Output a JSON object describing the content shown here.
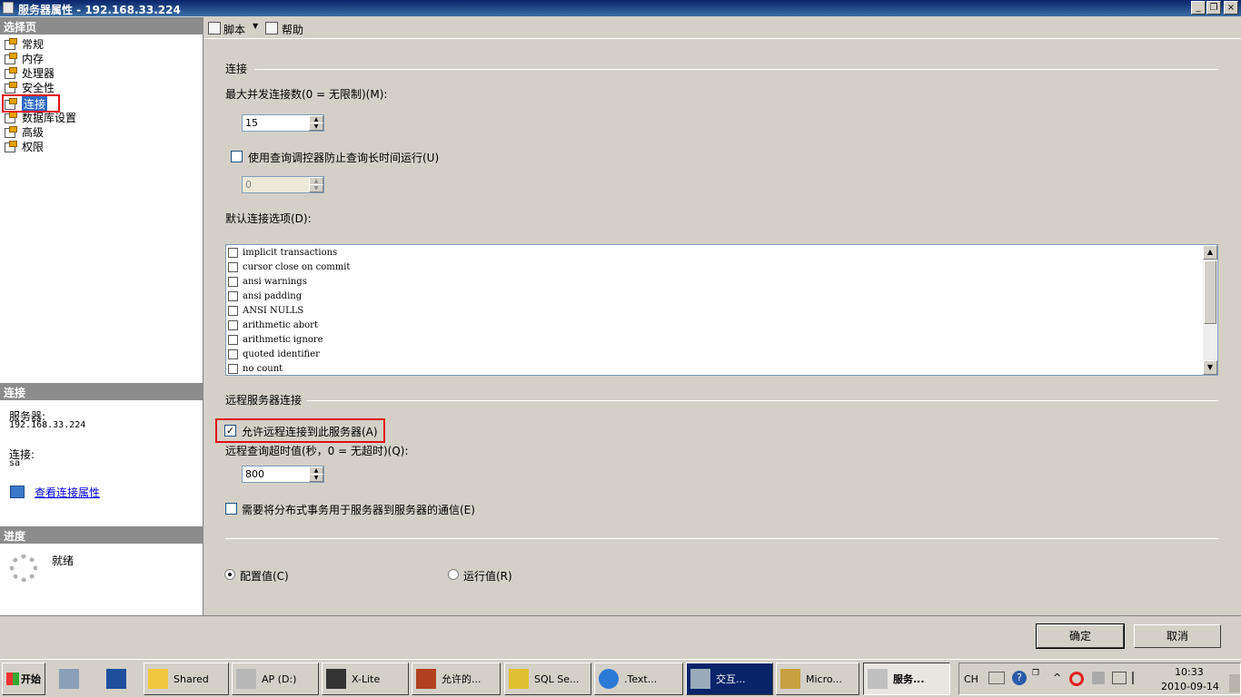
{
  "window": {
    "title": "服务器属性 - 192.168.33.224",
    "min": "_",
    "restore": "❐",
    "close": "×"
  },
  "left": {
    "select_page_header": "选择页",
    "nav": [
      {
        "label": "常规"
      },
      {
        "label": "内存"
      },
      {
        "label": "处理器"
      },
      {
        "label": "安全性"
      },
      {
        "label": "连接"
      },
      {
        "label": "数据库设置"
      },
      {
        "label": "高级"
      },
      {
        "label": "权限"
      }
    ],
    "connection_header": "连接",
    "server_label": "服务器:",
    "server_value": "192.168.33.224",
    "conn_label": "连接:",
    "conn_value": "sa",
    "view_conn_props": "查看连接属性",
    "progress_header": "进度",
    "progress_status": "就绪"
  },
  "toolbar": {
    "script": "脚本",
    "help": "帮助"
  },
  "main": {
    "conn_section": "连接",
    "max_conn_label": "最大并发连接数(0 = 无限制)(M):",
    "max_conn_value": "15",
    "query_gov_label": "使用查询调控器防止查询长时间运行(U)",
    "query_gov_value": "0",
    "default_opts_label": "默认连接选项(D):",
    "options": [
      "implicit transactions",
      "cursor close on commit",
      "ansi warnings",
      "ansi padding",
      "ANSI NULLS",
      "arithmetic abort",
      "arithmetic ignore",
      "quoted identifier",
      "no count"
    ],
    "remote_section": "远程服务器连接",
    "allow_remote_label": "允许远程连接到此服务器(A)",
    "allow_remote_checked": true,
    "remote_timeout_label": "远程查询超时值(秒，0 = 无超时)(Q):",
    "remote_timeout_value": "800",
    "dist_tx_label": "需要将分布式事务用于服务器到服务器的通信(E)",
    "radio_config": "配置值(C)",
    "radio_running": "运行值(R)"
  },
  "buttons": {
    "ok": "确定",
    "cancel": "取消"
  },
  "taskbar": {
    "start": "开始",
    "items": [
      {
        "label": "Shared"
      },
      {
        "label": "AP (D:)"
      },
      {
        "label": "X-Lite"
      },
      {
        "label": "允许的..."
      },
      {
        "label": "SQL Se..."
      },
      {
        "label": ".Text..."
      },
      {
        "label": "交互..."
      },
      {
        "label": "Micro..."
      },
      {
        "label": "服务..."
      }
    ],
    "lang": "CH",
    "time": "10:33",
    "date": "2010-09-14"
  }
}
